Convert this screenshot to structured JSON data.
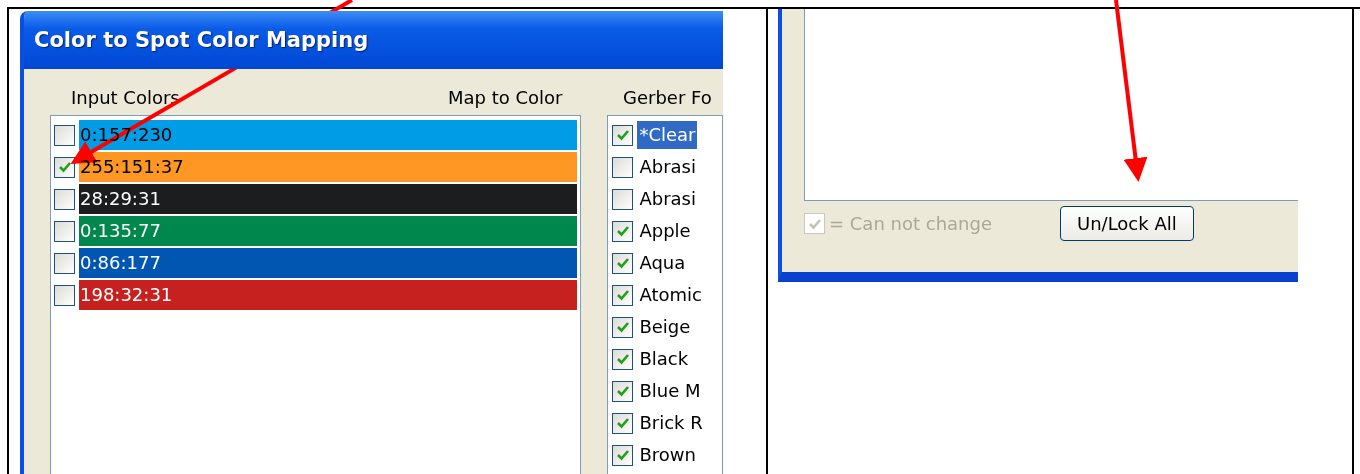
{
  "left_dialog": {
    "title": "Color to Spot Color Mapping",
    "column_headers": [
      "Input Colors",
      "Map to Color",
      "Gerber Fo"
    ],
    "input_colors": [
      {
        "label": "0:157:230",
        "checked": false,
        "color": "#009de6"
      },
      {
        "label": "255:151:37",
        "checked": true,
        "color": "#ff9725"
      },
      {
        "label": "28:29:31",
        "checked": false,
        "color": "#1c1d1f"
      },
      {
        "label": "0:135:77",
        "checked": false,
        "color": "#00874d"
      },
      {
        "label": "0:86:177",
        "checked": false,
        "color": "#0056b1"
      },
      {
        "label": "198:32:31",
        "checked": false,
        "color": "#c6201f"
      }
    ],
    "gerber_colors": [
      {
        "label": "*Clear",
        "checked": true,
        "selected": true
      },
      {
        "label": "Abrasi",
        "checked": false,
        "selected": false
      },
      {
        "label": "Abrasi",
        "checked": false,
        "selected": false
      },
      {
        "label": "Apple",
        "checked": true,
        "selected": false
      },
      {
        "label": "Aqua",
        "checked": true,
        "selected": false
      },
      {
        "label": "Atomic",
        "checked": true,
        "selected": false
      },
      {
        "label": "Beige",
        "checked": true,
        "selected": false
      },
      {
        "label": "Black",
        "checked": true,
        "selected": false
      },
      {
        "label": "Blue M",
        "checked": true,
        "selected": false
      },
      {
        "label": "Brick R",
        "checked": true,
        "selected": false
      },
      {
        "label": "Brown",
        "checked": true,
        "selected": false
      }
    ]
  },
  "right_dialog": {
    "legend": {
      "label": "= Can not change",
      "checked": true,
      "disabled": true
    },
    "button": "Un/Lock All"
  }
}
